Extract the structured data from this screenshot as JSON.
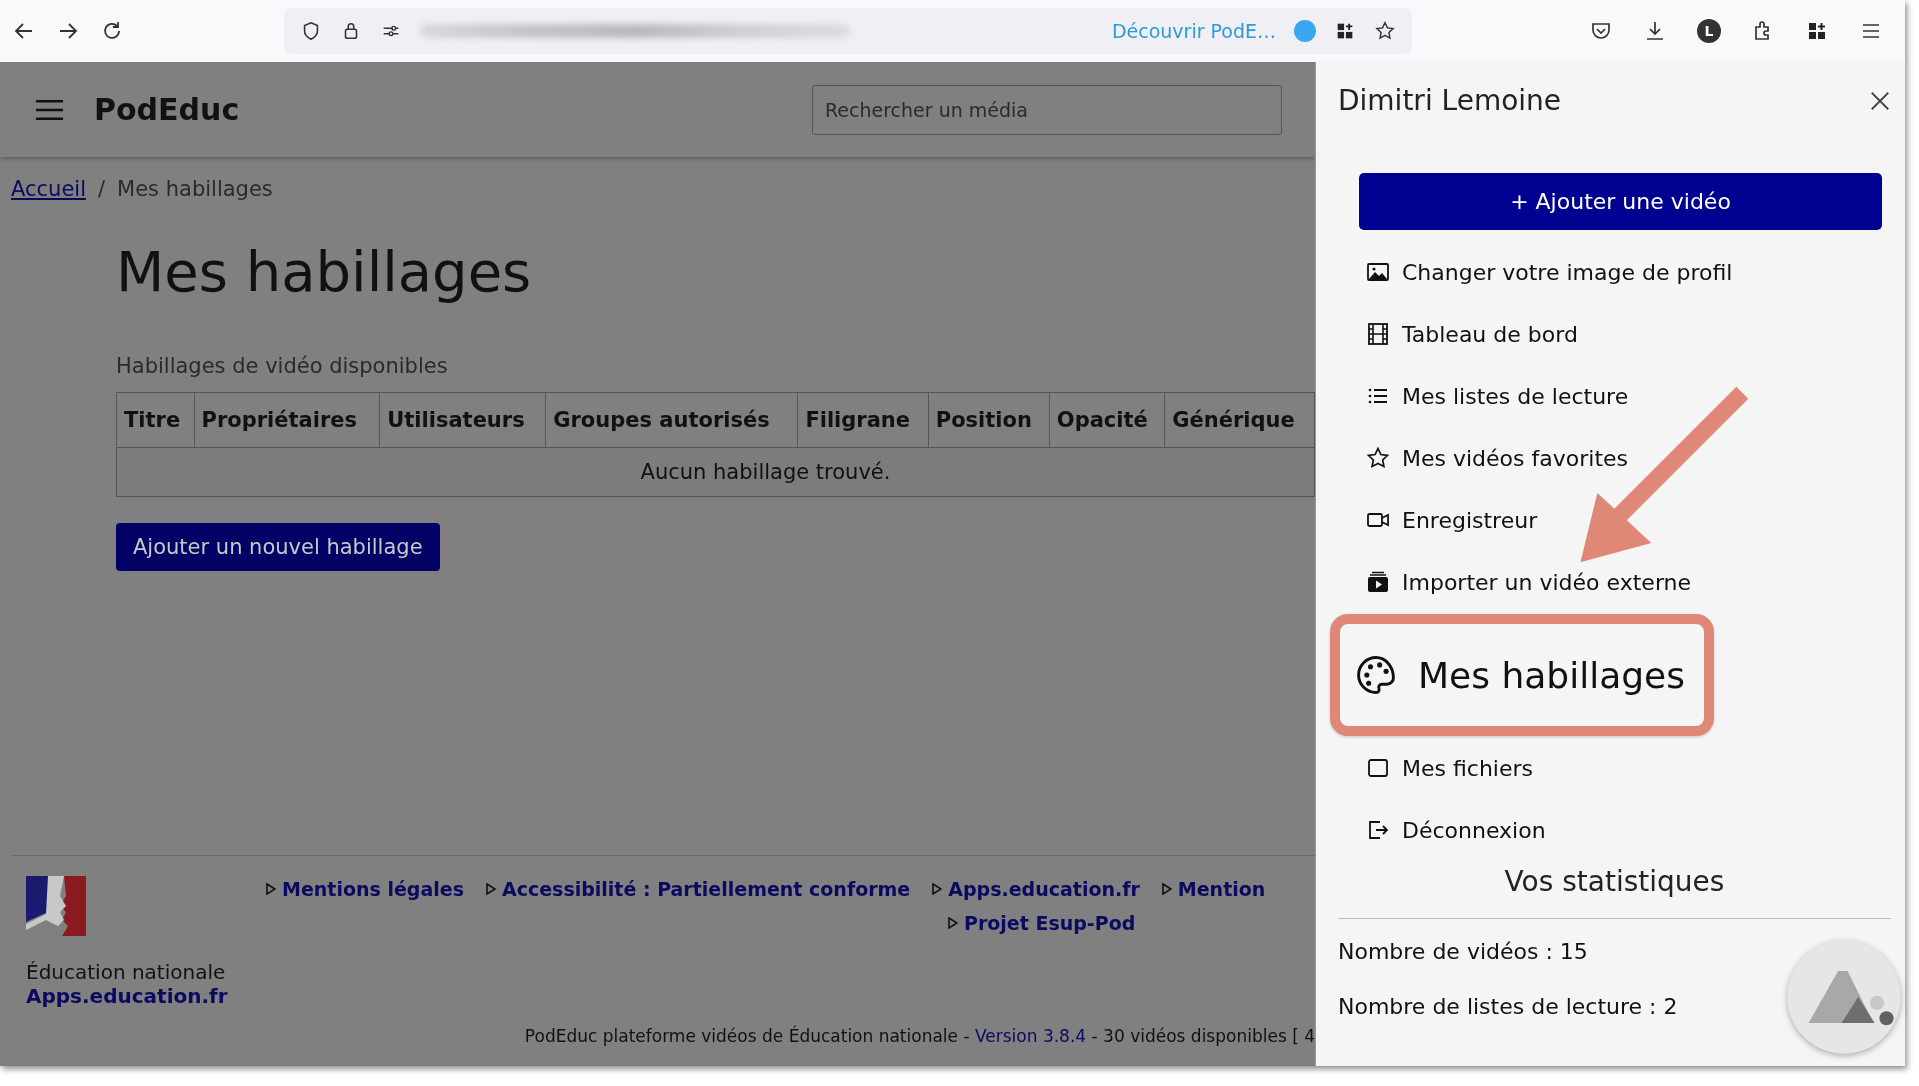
{
  "browser": {
    "promo_link": "Découvrir PodE…",
    "account_initial": "L"
  },
  "header": {
    "logo": "PodEduc",
    "search": {
      "placeholder": "Rechercher un média"
    }
  },
  "breadcrumb": [
    {
      "label": "Accueil",
      "kind": "link"
    },
    {
      "label": "Mes habillages",
      "kind": "current"
    }
  ],
  "breadcrumb_separator": "/",
  "page_title": "Mes habillages",
  "table": {
    "caption": "Habillages de vidéo disponibles",
    "columns": [
      "Titre",
      "Propriétaires",
      "Utilisateurs",
      "Groupes autorisés",
      "Filigrane",
      "Position",
      "Opacité",
      "Générique"
    ],
    "empty_message": "Aucun habillage trouvé."
  },
  "add_button": "Ajouter un nouvel habillage",
  "footer": {
    "link_rows": [
      [
        "Mentions légales",
        "Accessibilité : Partiellement conforme",
        "Apps.education.fr",
        "Mention"
      ],
      [
        "Projet Esup-Pod"
      ]
    ],
    "org_name": "Éducation nationale",
    "org_link": "Apps.education.fr",
    "note": {
      "before": "PodEduc plateforme vidéos de Éducation nationale - ",
      "link": "Version 3.8.4",
      "after": " - 30 vidéos disponibles [ 4"
    }
  },
  "panel": {
    "user_name": "Dimitri Lemoine",
    "add_button": "+ Ajouter une vidéo",
    "items": [
      {
        "label": "Changer votre image de profil",
        "kind": "image"
      },
      {
        "label": "Tableau de bord",
        "kind": "film"
      },
      {
        "label": "Mes listes de lecture",
        "kind": "list"
      },
      {
        "label": "Mes vidéos favorites",
        "kind": "star"
      },
      {
        "label": "Enregistreur",
        "kind": "camera"
      },
      {
        "label": "Importer un vidéo externe",
        "kind": "import"
      },
      {
        "label": "Mes fichiers",
        "kind": "file"
      },
      {
        "label": "Déconnexion",
        "kind": "logout"
      }
    ],
    "stats_title": "Vos statistiques",
    "stats": [
      "Nombre de vidéos : 15",
      "Nombre de listes de lecture : 2"
    ]
  },
  "callout": {
    "label": "Mes habillages"
  }
}
